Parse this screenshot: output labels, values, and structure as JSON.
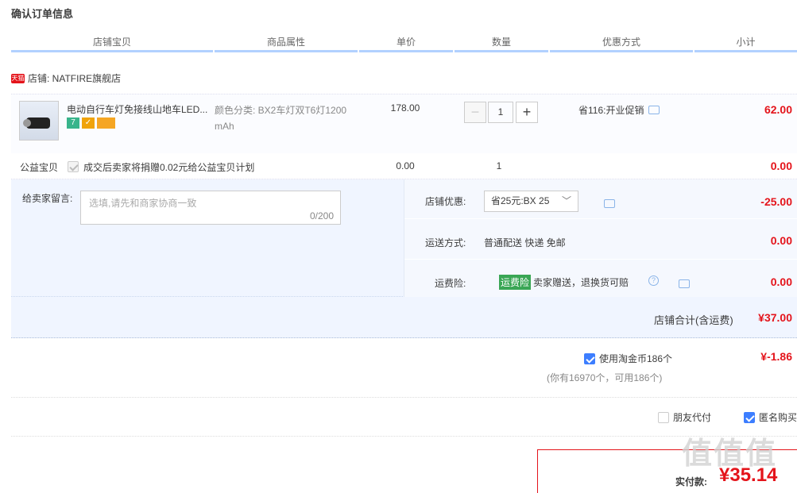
{
  "page_title": "确认订单信息",
  "headers": [
    "店铺宝贝",
    "商品属性",
    "单价",
    "数量",
    "优惠方式",
    "小计"
  ],
  "shop": {
    "badge": "天猫",
    "label": "店铺: NATFIRE旗舰店"
  },
  "item": {
    "name": "电动自行车灯免接线山地车LED...",
    "attr_line1": "颜色分类: BX2车灯双T6灯1200",
    "attr_line2": "mAh",
    "price": "178.00",
    "qty_minus": "−",
    "qty": "1",
    "qty_plus": "+",
    "promo": "省116:开业促销",
    "subtotal": "62.00",
    "badge_texts": [
      "7",
      "✓",
      ""
    ],
    "badge_colors": [
      "#38b48b",
      "#f0a30a",
      "#f5a623"
    ]
  },
  "charity": {
    "label": "公益宝贝",
    "text": "成交后卖家将捐赠0.02元给公益宝贝计划",
    "price": "0.00",
    "qty": "1",
    "subtotal": "0.00"
  },
  "message": {
    "label": "给卖家留言:",
    "placeholder": "选填,请先和商家协商一致",
    "count": "0/200"
  },
  "shop_discount": {
    "label": "店铺优惠:",
    "value": "省25元:BX 25",
    "amount": "-25.00"
  },
  "shipping": {
    "label": "运送方式:",
    "value": "普通配送 快递 免邮",
    "amount": "0.00"
  },
  "insurance": {
    "label": "运费险:",
    "tag": "运费险",
    "text": "卖家赠送，退换货可赔",
    "amount": "0.00"
  },
  "shop_total": {
    "label": "店铺合计(含运费)",
    "amount": "¥37.00"
  },
  "taobao_coin": {
    "label": "使用淘金币186个",
    "note": "(你有16970个，可用186个)",
    "amount": "¥-1.86"
  },
  "options": {
    "friend_pay": "朋友代付",
    "anonymous": "匿名购买"
  },
  "pay": {
    "label": "实付款:",
    "amount": "¥35.14"
  },
  "watermark": "值值值 什么值得买"
}
